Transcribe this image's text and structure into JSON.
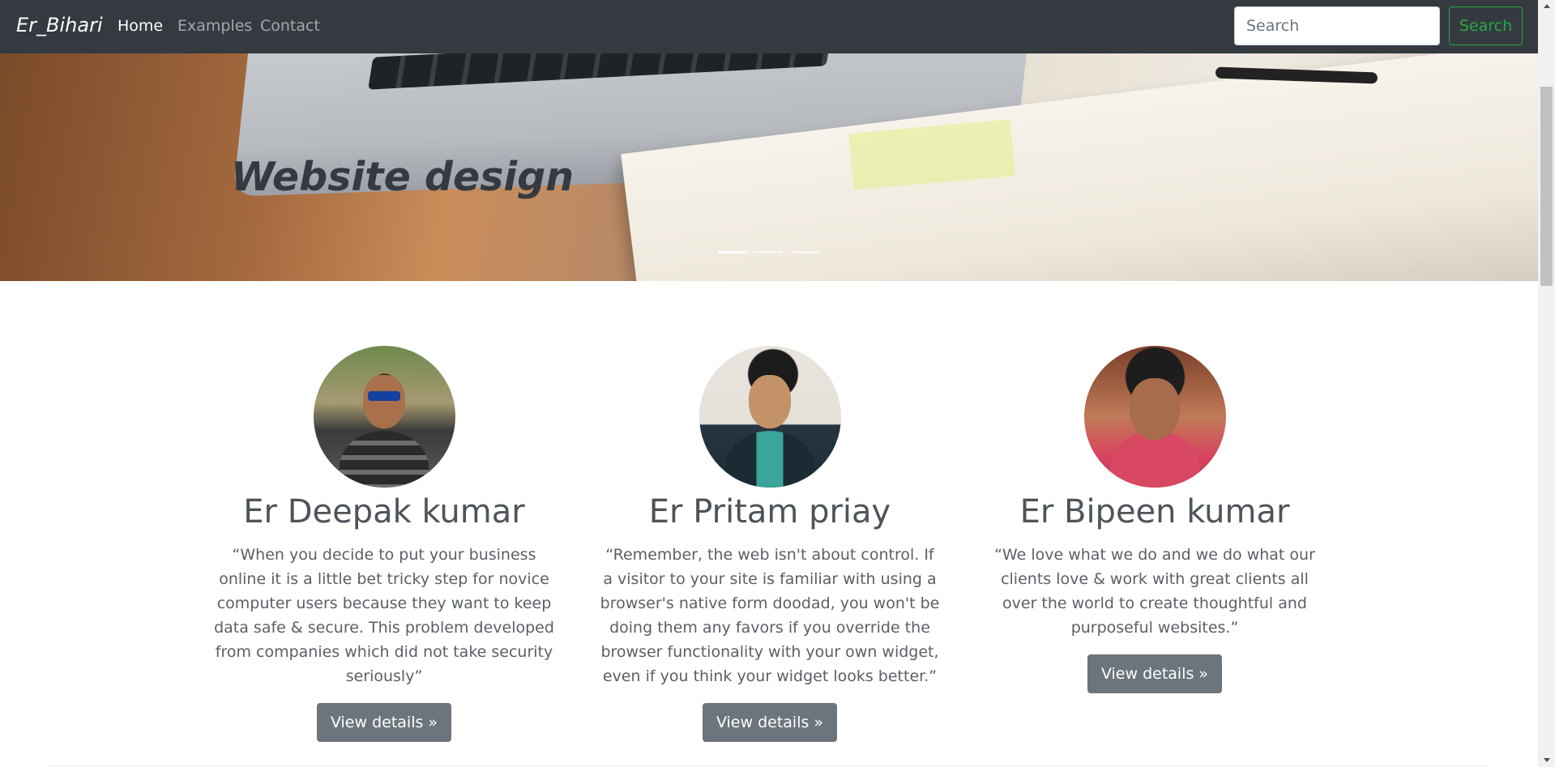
{
  "navbar": {
    "brand": "Er_Bihari",
    "links": [
      {
        "label": "Home",
        "active": true
      },
      {
        "label": "Examples",
        "active": false
      },
      {
        "label": "Contact",
        "active": false
      }
    ],
    "search": {
      "placeholder": "Search",
      "value": "",
      "button_label": "Search"
    }
  },
  "carousel": {
    "caption": "Website design",
    "indicator_count": 3,
    "active_index": 0
  },
  "team": [
    {
      "name": "Er Deepak kumar",
      "quote": "“When you decide to put your business online it is a little bet tricky step for novice computer users because they want to keep data safe & secure. This problem developed from companies which did not take security seriously”",
      "button_label": "View details »"
    },
    {
      "name": "Er Pritam priay",
      "quote": "“Remember, the web isn't about control. If a visitor to your site is familiar with using a browser's native form doodad, you won't be doing them any favors if you override the browser functionality with your own widget, even if you think your widget looks better.”",
      "button_label": "View details »"
    },
    {
      "name": "Er Bipeen kumar",
      "quote": "“We love what we do and we do what our clients love & work with great clients all over the world to create thoughtful and purposeful websites.”",
      "button_label": "View details »"
    }
  ],
  "colors": {
    "navbar_bg": "#343a40",
    "search_button": "#28a745",
    "details_button": "#6c757d"
  }
}
